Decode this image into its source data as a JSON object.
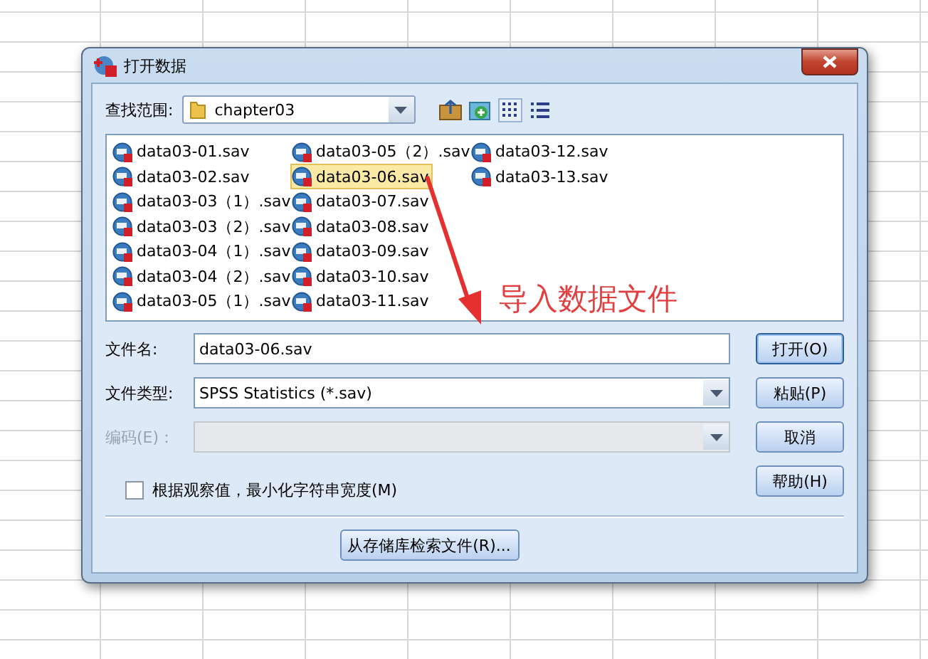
{
  "window": {
    "title": "打开数据"
  },
  "look_in": {
    "label": "查找范围:",
    "value": "chapter03"
  },
  "files": [
    {
      "name": "data03-01.sav",
      "selected": false
    },
    {
      "name": "data03-02.sav",
      "selected": false
    },
    {
      "name": "data03-03（1）.sav",
      "selected": false
    },
    {
      "name": "data03-03（2）.sav",
      "selected": false
    },
    {
      "name": "data03-04（1）.sav",
      "selected": false
    },
    {
      "name": "data03-04（2）.sav",
      "selected": false
    },
    {
      "name": "data03-05（1）.sav",
      "selected": false
    },
    {
      "name": "data03-05（2）.sav",
      "selected": false
    },
    {
      "name": "data03-06.sav",
      "selected": true
    },
    {
      "name": "data03-07.sav",
      "selected": false
    },
    {
      "name": "data03-08.sav",
      "selected": false
    },
    {
      "name": "data03-09.sav",
      "selected": false
    },
    {
      "name": "data03-10.sav",
      "selected": false
    },
    {
      "name": "data03-11.sav",
      "selected": false
    },
    {
      "name": "data03-12.sav",
      "selected": false
    },
    {
      "name": "data03-13.sav",
      "selected": false
    }
  ],
  "fields": [
    {
      "label": "文件名:",
      "kind": "text",
      "value": "data03-06.sav",
      "disabled": false
    },
    {
      "label": "文件类型:",
      "kind": "select",
      "value": "SPSS Statistics (*.sav)",
      "disabled": false
    },
    {
      "label": "编码(E)：",
      "kind": "select",
      "disabled": true
    }
  ],
  "buttons": [
    {
      "label": "打开(O)",
      "default": true
    },
    {
      "label": "粘贴(P)",
      "default": false
    },
    {
      "label": "取消",
      "default": false
    },
    {
      "label": "帮助(H)",
      "default": false
    }
  ],
  "checkbox": {
    "label": "根据观察值，最小化字符串宽度(M)",
    "checked": false
  },
  "repository_button": "从存储库检索文件(R)...",
  "annotation": {
    "text": "导入数据文件"
  }
}
